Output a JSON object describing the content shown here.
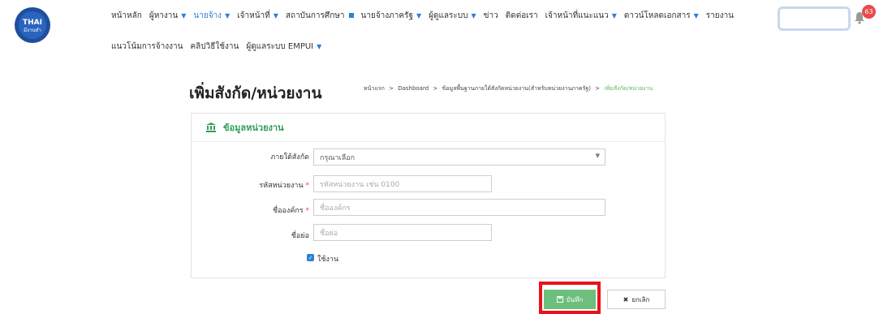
{
  "logo": {
    "text_top": "THAI",
    "text_bottom": "มีงานทำ"
  },
  "nav": {
    "row1": [
      {
        "label": "หน้าหลัก",
        "marker": ""
      },
      {
        "label": "ผู้หางาน",
        "marker": "caret"
      },
      {
        "label": "นายจ้าง",
        "marker": "caret",
        "active": true
      },
      {
        "label": "เจ้าหน้าที่",
        "marker": "caret"
      },
      {
        "label": "สถาบันการศึกษา",
        "marker": "square"
      },
      {
        "label": "นายจ้างภาครัฐ",
        "marker": "caret"
      },
      {
        "label": "ผู้ดูแลระบบ",
        "marker": "caret"
      },
      {
        "label": "ข่าว",
        "marker": ""
      },
      {
        "label": "ติดต่อเรา",
        "marker": ""
      },
      {
        "label": "เจ้าหน้าที่แนะแนว",
        "marker": "caret"
      },
      {
        "label": "ดาวน์โหลดเอกสาร",
        "marker": "caret"
      },
      {
        "label": "รายงาน",
        "marker": ""
      }
    ],
    "row2": [
      {
        "label": "แนวโน้มการจ้างงาน",
        "marker": ""
      },
      {
        "label": "คลิปวิธีใช้งาน",
        "marker": ""
      },
      {
        "label": "ผู้ดูแลระบบ EMPUI",
        "marker": "caret"
      }
    ]
  },
  "notifications": {
    "count": "63"
  },
  "page": {
    "title": "เพิ่มสังกัด/หน่วยงาน"
  },
  "breadcrumb": {
    "home": "หน้าแรก",
    "sep": ">",
    "dashboard": "Dashboard",
    "parent": "ข้อมูลพื้นฐานภายใต้สังกัดหน่วยงาน(สำหรับหน่วยงานภาครัฐ)",
    "current": "เพิ่มสังกัด/หน่วยงาน"
  },
  "panel": {
    "title": "ข้อมูลหน่วยงาน"
  },
  "form": {
    "affiliation": {
      "label": "ภายใต้สังกัด",
      "value": "กรุณาเลือก"
    },
    "unit_code": {
      "label": "รหัสหน่วยงาน",
      "required_mark": "*",
      "placeholder": "รหัสหน่วยงาน เช่น 0100"
    },
    "org_name": {
      "label": "ชื่อองค์กร",
      "required_mark": "*",
      "placeholder": "ชื่อองค์กร"
    },
    "short_name": {
      "label": "ชื่อย่อ",
      "placeholder": "ชื่อย่อ"
    },
    "active": {
      "label": "ใช้งาน",
      "checked": true
    }
  },
  "buttons": {
    "save": "บันทึก",
    "cancel": "ยกเลิก"
  },
  "colors": {
    "accent": "#2e7fd9",
    "green": "#2f9e57",
    "save_bg": "#6cbf7c",
    "highlight": "#e8131b",
    "badge": "#e94b4b"
  }
}
